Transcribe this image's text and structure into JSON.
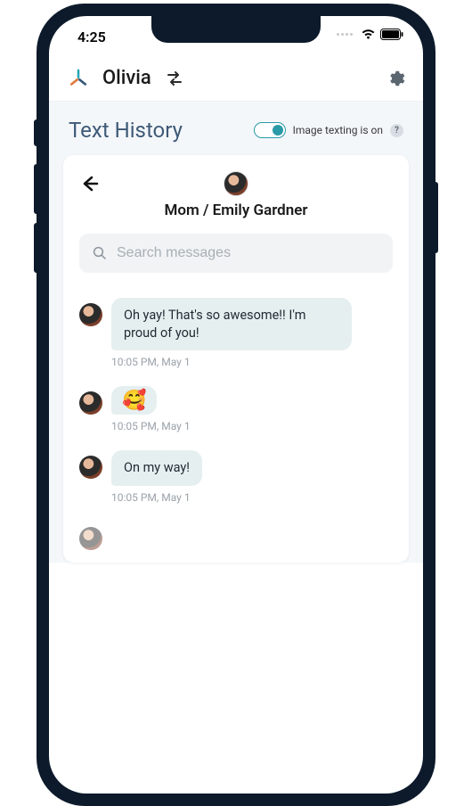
{
  "status": {
    "time": "4:25"
  },
  "header": {
    "profile_name": "Olivia"
  },
  "subheader": {
    "title": "Text History",
    "toggle_label": "Image texting is on",
    "help_glyph": "?"
  },
  "conversation": {
    "contact_name": "Mom / Emily Gardner",
    "search_placeholder": "Search messages",
    "messages": [
      {
        "text": "Oh yay! That's so awesome!! I'm proud of you!",
        "time": "10:05 PM, May 1",
        "emoji": false
      },
      {
        "text": "🥰",
        "time": "10:05 PM, May 1",
        "emoji": true
      },
      {
        "text": "On my way!",
        "time": "10:05 PM, May 1",
        "emoji": false
      }
    ]
  }
}
